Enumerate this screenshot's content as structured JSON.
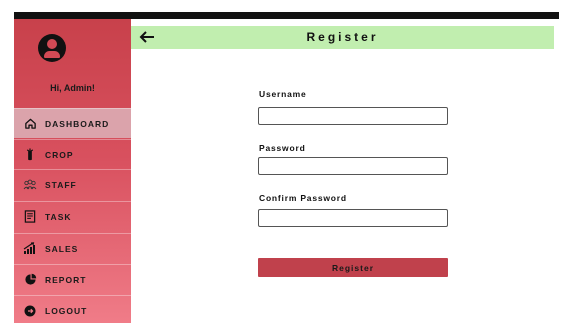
{
  "sidebar": {
    "greeting": "Hi, Admin!",
    "items": [
      {
        "label": "DASHBOARD",
        "icon": "home-icon",
        "active": true
      },
      {
        "label": "CROP",
        "icon": "crop-icon",
        "active": false
      },
      {
        "label": "STAFF",
        "icon": "staff-icon",
        "active": false
      },
      {
        "label": "TASK",
        "icon": "task-icon",
        "active": false
      },
      {
        "label": "SALES",
        "icon": "sales-icon",
        "active": false
      },
      {
        "label": "REPORT",
        "icon": "report-icon",
        "active": false
      },
      {
        "label": "LOGOUT",
        "icon": "logout-icon",
        "active": false
      }
    ]
  },
  "header": {
    "title": "Register"
  },
  "form": {
    "username_label": "Username",
    "username_value": "",
    "password_label": "Password",
    "password_value": "",
    "confirm_label": "Confirm Password",
    "confirm_value": "",
    "submit_label": "Register"
  },
  "colors": {
    "sidebar": "#c8414b",
    "header": "#c1eeaf",
    "button": "#c0414c",
    "active_item": "#dba3ab"
  }
}
